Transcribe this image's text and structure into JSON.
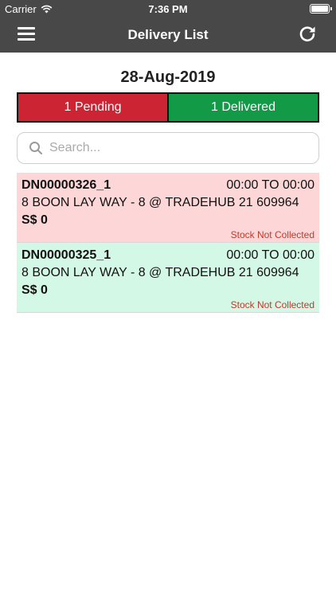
{
  "status_bar": {
    "carrier": "Carrier",
    "time": "7:36 PM",
    "icons": [
      "wifi-icon",
      "battery-icon"
    ]
  },
  "nav": {
    "title": "Delivery List",
    "left_icon": "menu-icon",
    "right_icon": "refresh-icon"
  },
  "date": "28-Aug-2019",
  "segment": {
    "pending_label": "1 Pending",
    "delivered_label": "1 Delivered",
    "pending_color": "#cc2433",
    "delivered_color": "#129a47"
  },
  "search": {
    "placeholder": "Search...",
    "value": ""
  },
  "deliveries": [
    {
      "dn": "DN00000326_1",
      "slot": "00:00 TO 00:00",
      "address": "8 BOON LAY WAY - 8 @ TRADEHUB 21 609964",
      "amount": "S$ 0",
      "status": "Stock Not Collected",
      "state": "pending",
      "bg": "#fdd7d8"
    },
    {
      "dn": "DN00000325_1",
      "slot": "00:00 TO 00:00",
      "address": "8 BOON LAY WAY - 8 @ TRADEHUB 21 609964",
      "amount": "S$ 0",
      "status": "Stock Not Collected",
      "state": "delivered",
      "bg": "#d3f8e5"
    }
  ]
}
